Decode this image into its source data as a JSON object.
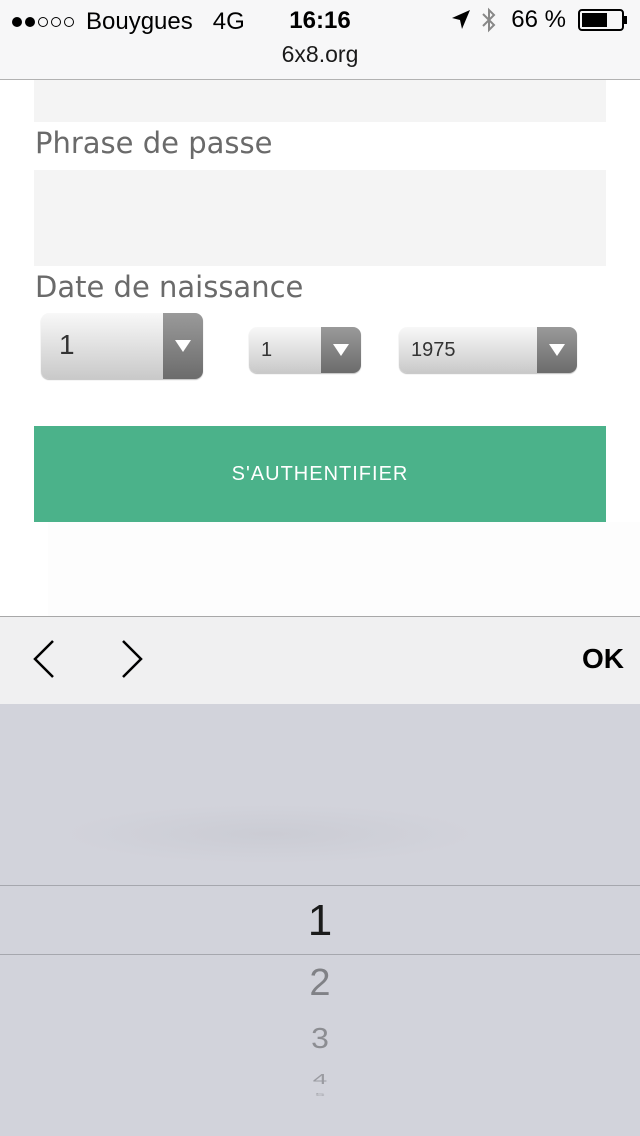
{
  "status_bar": {
    "signal_dots_filled": 2,
    "signal_dots_total": 5,
    "carrier": "Bouygues",
    "network": "4G",
    "time": "16:16",
    "battery_percent": "66 %",
    "battery_level": 0.66,
    "icons": [
      "location-arrow-icon",
      "bluetooth-icon",
      "battery-icon"
    ]
  },
  "browser": {
    "url": "6x8.org"
  },
  "form": {
    "passphrase_label": "Phrase de passe",
    "passphrase_value": "",
    "dob_label": "Date de naissance",
    "day_value": "1",
    "month_value": "1",
    "year_value": "1975",
    "submit_label": "S'AUTHENTIFIER"
  },
  "accessory_bar": {
    "prev_icon": "chevron-left-icon",
    "next_icon": "chevron-right-icon",
    "done_label": "OK"
  },
  "picker": {
    "items": [
      "1",
      "2",
      "3",
      "4",
      "5"
    ],
    "selected_index": 0
  },
  "colors": {
    "button": "#4bb28a",
    "field_background": "#f4f4f4",
    "picker_background": "#d2d3db",
    "label_text": "#6a6a6a"
  }
}
